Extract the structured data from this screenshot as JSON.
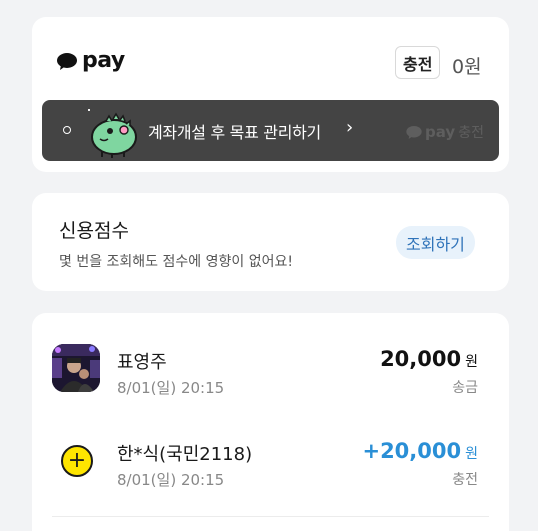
{
  "pay": {
    "logo_text": "pay",
    "charge_label": "충전",
    "balance": "0원",
    "banner": {
      "text": "계좌개설 후 목표 관리하기",
      "chevron": "›",
      "tag_pay": "pay",
      "tag_text": "충전"
    }
  },
  "credit": {
    "title": "신용점수",
    "subtitle": "몇 번을 조회해도 점수에 영향이 없어요!",
    "lookup_label": "조회하기"
  },
  "transactions": [
    {
      "name": "표영주",
      "date": "8/01(일) 20:15",
      "amount": "20,000",
      "unit": "원",
      "type": "송금",
      "icon": "profile-photo"
    },
    {
      "name": "한*식(국민2118)",
      "date": "8/01(일) 20:15",
      "amount": "+20,000",
      "unit": "원",
      "type": "충전",
      "icon": "plus-icon"
    }
  ],
  "colors": {
    "background": "#f2f3f5",
    "banner": "#444444",
    "accent_blue": "#2a8fd6",
    "kakao_yellow": "#fee500",
    "lookup_bg": "#e8f2fb"
  }
}
